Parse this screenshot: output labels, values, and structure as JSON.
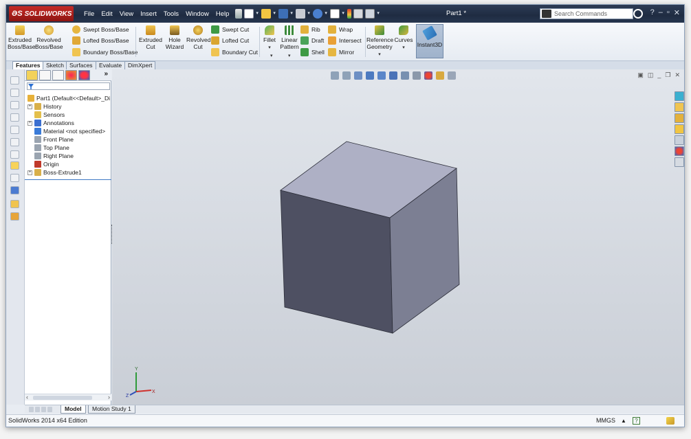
{
  "app": {
    "logo_brand": "SOLIDWORKS",
    "doc_title": "Part1 *"
  },
  "menu": [
    "File",
    "Edit",
    "View",
    "Insert",
    "Tools",
    "Window",
    "Help"
  ],
  "search": {
    "placeholder": "Search Commands"
  },
  "window_buttons": {
    "minimize": "–",
    "restore": "▫",
    "close": "✕"
  },
  "commands": {
    "extruded_boss": [
      "Extruded",
      "Boss/Base"
    ],
    "revolved_boss": [
      "Revolved",
      "Boss/Base"
    ],
    "swept_boss": "Swept Boss/Base",
    "lofted_boss": "Lofted Boss/Base",
    "boundary_boss": "Boundary Boss/Base",
    "extruded_cut": [
      "Extruded",
      "Cut"
    ],
    "hole_wizard": [
      "Hole",
      "Wizard"
    ],
    "revolved_cut": [
      "Revolved",
      "Cut"
    ],
    "swept_cut": "Swept Cut",
    "lofted_cut": "Lofted Cut",
    "boundary_cut": "Boundary Cut",
    "fillet": "Fillet",
    "linear_pattern": [
      "Linear",
      "Pattern"
    ],
    "rib": "Rib",
    "draft": "Draft",
    "shell": "Shell",
    "wrap": "Wrap",
    "intersect": "Intersect",
    "mirror": "Mirror",
    "reference_geometry": [
      "Reference",
      "Geometry"
    ],
    "curves": "Curves",
    "instant3d": "Instant3D"
  },
  "cm_tabs": [
    "Features",
    "Sketch",
    "Surfaces",
    "Evaluate",
    "DimXpert"
  ],
  "tree": {
    "root": "Part1  (Default<<Default>_Disp",
    "items": [
      {
        "label": "History",
        "expand": "+",
        "icon_color": "#d9b04a"
      },
      {
        "label": "Sensors",
        "expand": "",
        "icon_color": "#e4c04c"
      },
      {
        "label": "Annotations",
        "expand": "+",
        "icon_color": "#3b6fd0"
      },
      {
        "label": "Material <not specified>",
        "expand": "",
        "icon_color": "#3a7bd8"
      },
      {
        "label": "Front Plane",
        "expand": "",
        "icon_color": "#9aa4b0"
      },
      {
        "label": "Top Plane",
        "expand": "",
        "icon_color": "#9aa4b0"
      },
      {
        "label": "Right Plane",
        "expand": "",
        "icon_color": "#9aa4b0"
      },
      {
        "label": "Origin",
        "expand": "",
        "icon_color": "#c0392b"
      },
      {
        "label": "Boss-Extrude1",
        "expand": "+",
        "icon_color": "#d9b04a"
      }
    ]
  },
  "bottom_tabs": [
    "Model",
    "Motion Study 1"
  ],
  "status": {
    "edition": "SolidWorks 2014 x64 Edition",
    "units": "MMGS",
    "units_drop": "▲",
    "help": "?"
  },
  "triad": {
    "y": "Y",
    "z": "Z",
    "x": "X"
  },
  "colors": {
    "title_bg": "#1f2c42",
    "logo_red": "#c52a25",
    "cube_top": "#aeb0c5",
    "cube_front": "#4e5062",
    "cube_right": "#7c7f93",
    "viewport_top": "#e2e6ec",
    "viewport_bottom": "#c9ced6"
  }
}
